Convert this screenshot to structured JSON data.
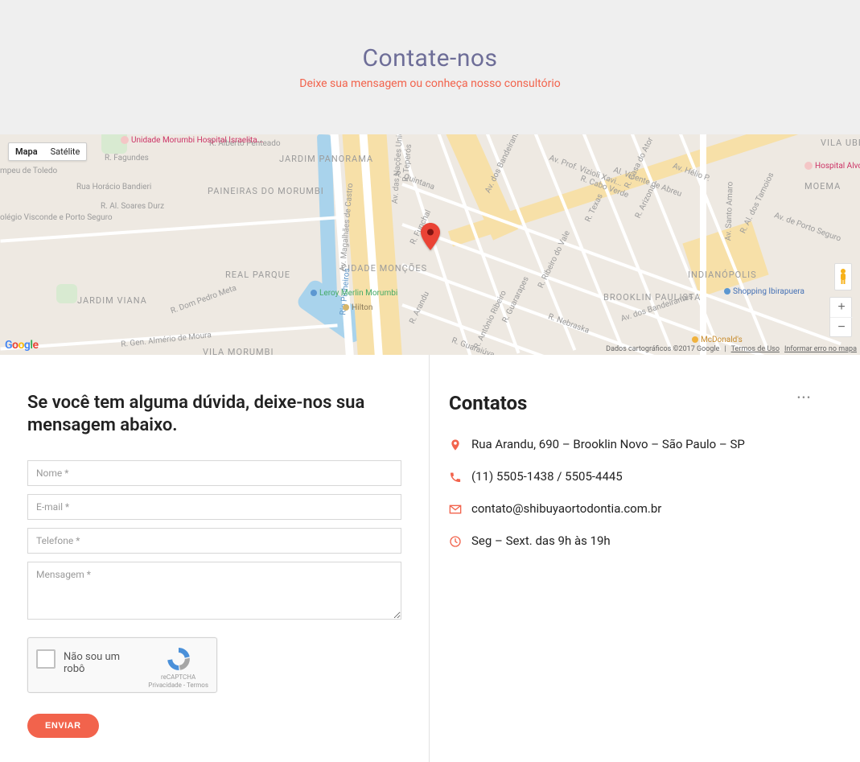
{
  "hero": {
    "title": "Contate-nos",
    "subtitle": "Deixe sua mensagem ou conheça nosso consultório"
  },
  "map": {
    "type_map": "Mapa",
    "type_sat": "Satélite",
    "attribution_data": "Dados cartográficos ©2017 Google",
    "attribution_terms": "Termos de Uso",
    "attribution_report": "Informar erro no mapa",
    "districts": {
      "jardim_panorama": "JARDIM\nPANORAMA",
      "paineiras": "PAINEIRAS DO\nMORUMBI",
      "real_parque": "REAL PARQUE",
      "jardim_viana": "JARDIM VIANA",
      "cidade_moncoes": "CIDADE\nMONÇÕES",
      "brooklin": "BROOKLIN\nPAULISTA",
      "vila_uberabinha": "VILA\nUBERABINHA",
      "moema": "MOEMA",
      "indianopolis": "INDIANÓPOLIS",
      "visconde": "olégio Visconde\ne Porto Seguro",
      "vila_morumbi_top": "VILA MORUMBI"
    },
    "roads": {
      "nacoes": "Av. das Nações Unidas",
      "bandeirantes": "Av. dos Bandeirantes",
      "castro": "Av. Magalhães de Castro",
      "penteado": "R. Alberto Penteado",
      "bandieri": "Rua Horácio Bandieri",
      "durz": "R. Al. Soares Durz",
      "quintana": "R. Quintana",
      "texas": "R. Texas",
      "funchal": "R. Funchal",
      "teperos": "R. Teperós",
      "helio": "Av. Hélio P.",
      "fagundes": "R. Fagundes",
      "arandu": "R. Arandu",
      "guararapes": "R. Guararapes",
      "ribeiro": "R. Ribeiro do Vale",
      "tamoios": "R. Al. dos Tamoios",
      "dom_pedro": "R. Dom Pedro Meta",
      "almerio": "R. Gen. Almério de Moura",
      "nebraska": "R. Nebraska",
      "antonio": "R. Antônio Ribeiro",
      "arizona": "R. Arizona",
      "guaraiúva": "R. Guaraiúva",
      "hsanta": "Av. Santo Amaro",
      "cabo_verde": "R. Cabo Verde",
      "casa_ator": "R. Casa do Ator",
      "vinte": "Av. Prof. Vizioli Xavi...",
      "porto_seguro": "Av. de Porto Seguro",
      "gaioso": "Al. Vicente de Abreu",
      "pin_river": "Rio Pinheiros"
    },
    "pois": {
      "leroy": "Leroy Merlin Morumbi",
      "hilton": "Hilton",
      "mcd": "McDonald's",
      "shopping": "Shopping Ibirapuera",
      "morumbi": "Unidade Morumbi\nHospital Israelita...",
      "alvorada": "Hospital Alvorada...",
      "toledo": "mpeu de Toledo"
    }
  },
  "form": {
    "heading": "Se você tem alguma dúvida, deixe-nos sua mensagem abaixo.",
    "name_ph": "Nome *",
    "email_ph": "E-mail *",
    "phone_ph": "Telefone *",
    "msg_ph": "Mensagem *",
    "recaptcha_label": "Não sou um robô",
    "recaptcha_brand": "reCAPTCHA",
    "recaptcha_links": "Privacidade - Termos",
    "submit": "ENVIAR"
  },
  "contacts": {
    "heading": "Contatos",
    "address": "Rua Arandu, 690 – Brooklin Novo – São Paulo – SP",
    "phone": "(11) 5505-1438 / 5505-4445",
    "email": "contato@shibuyaortodontia.com.br",
    "hours": "Seg – Sext. das 9h às 19h"
  }
}
